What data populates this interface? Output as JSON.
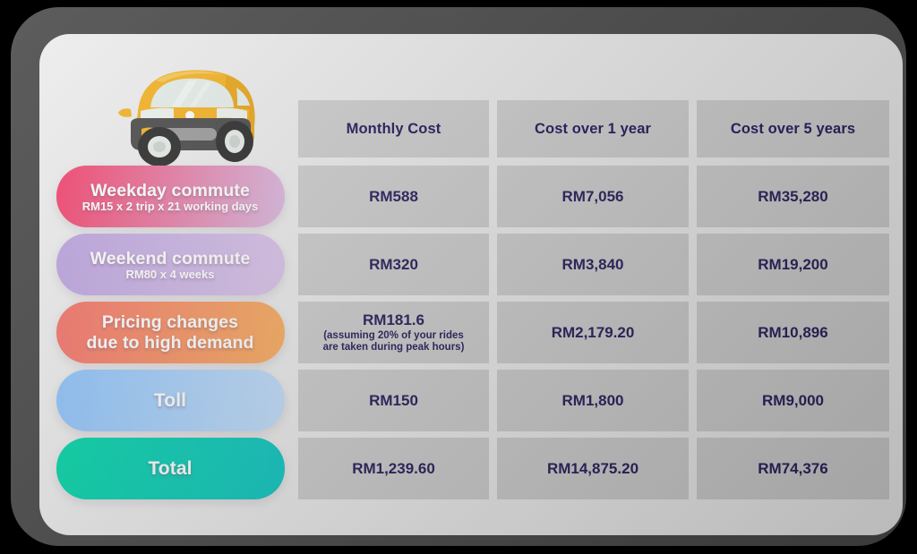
{
  "device": {
    "frame_color": "#4a4a4a",
    "screen_bg": "#eeeeee"
  },
  "illustration": {
    "name": "yellow-hatchback-car",
    "body_color": "#f5b426",
    "body_color_dark": "#e39a16",
    "glass_color": "#e7eeea",
    "bumper_color": "#4d4d4d"
  },
  "table": {
    "columns": [
      {
        "label": "Monthly Cost"
      },
      {
        "label": "Cost over 1 year"
      },
      {
        "label": "Cost over 5 years"
      }
    ],
    "rows": [
      {
        "label": "Weekday commute",
        "sublabel": "RM15 x 2 trip x 21 working days",
        "pill_from": "#f4436c",
        "pill_to": "#ddbde4",
        "values": [
          "RM588",
          "RM7,056",
          "RM35,280"
        ],
        "note": ""
      },
      {
        "label": "Weekend commute",
        "sublabel": "RM80 x 4 weeks",
        "pill_from": "#bda5e0",
        "pill_to": "#ddc7ec",
        "values": [
          "RM320",
          "RM3,840",
          "RM19,200"
        ],
        "note": ""
      },
      {
        "label": "Pricing changes\ndue to high demand",
        "sublabel": "",
        "pill_from": "#f4746e",
        "pill_to": "#fcb262",
        "values": [
          "RM181.6",
          "RM2,179.20",
          "RM10,896"
        ],
        "note": "(assuming 20% of your rides\nare taken during peak hours)"
      },
      {
        "label": "Toll",
        "sublabel": "",
        "pill_from": "#8fc4fb",
        "pill_to": "#c6e1fd",
        "values": [
          "RM150",
          "RM1,800",
          "RM9,000"
        ],
        "note": ""
      },
      {
        "label": "Total",
        "sublabel": "",
        "pill_from": "#05d6a8",
        "pill_to": "#13c9c6",
        "values": [
          "RM1,239.60",
          "RM14,875.20",
          "RM74,376"
        ],
        "note": ""
      }
    ]
  },
  "colors": {
    "cell_bg": "#d0d0d0",
    "value_text": "#2b205e",
    "header_text": "#231a5c"
  },
  "chart_data": {
    "type": "table",
    "title": "",
    "columns": [
      "",
      "Monthly Cost",
      "Cost over 1 year",
      "Cost over 5 years"
    ],
    "rows": [
      [
        "Weekday commute (RM15 x 2 trip x 21 working days)",
        "RM588",
        "RM7,056",
        "RM35,280"
      ],
      [
        "Weekend commute (RM80 x 4 weeks)",
        "RM320",
        "RM3,840",
        "RM19,200"
      ],
      [
        "Pricing changes due to high demand",
        "RM181.6 (assuming 20% of your rides are taken during peak hours)",
        "RM2,179.20",
        "RM10,896"
      ],
      [
        "Toll",
        "RM150",
        "RM1,800",
        "RM9,000"
      ],
      [
        "Total",
        "RM1,239.60",
        "RM14,875.20",
        "RM74,376"
      ]
    ]
  }
}
